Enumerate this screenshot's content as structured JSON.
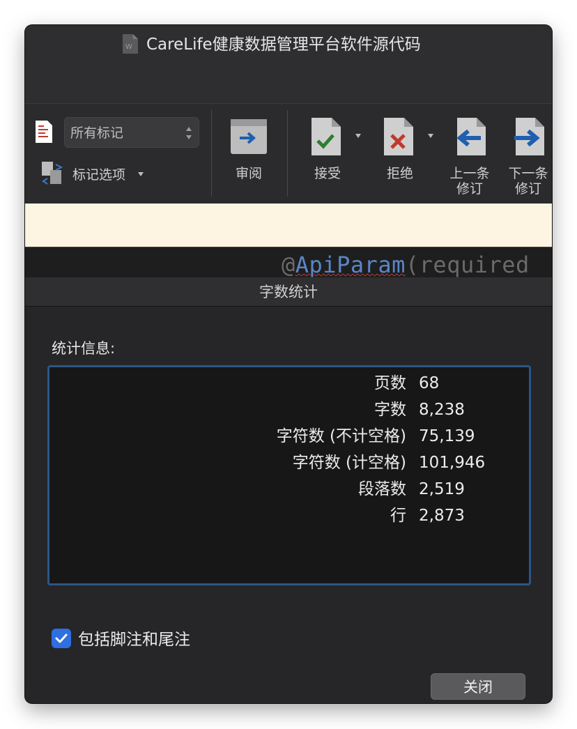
{
  "window": {
    "title": "CareLife健康数据管理平台软件源代码",
    "doc_icon": "word-document-icon"
  },
  "ribbon": {
    "markup_display_value": "所有标记",
    "markup_options_label": "标记选项",
    "review_label": "审阅",
    "accept_label": "接受",
    "reject_label": "拒绝",
    "previous_change_label_line1": "上一条",
    "previous_change_label_line2": "修订",
    "next_change_label_line1": "下一条",
    "next_change_label_line2": "修订"
  },
  "editor": {
    "code_prefix": "@",
    "code_keyword": "ApiParam",
    "code_suffix": "(required"
  },
  "dialog": {
    "title": "字数统计",
    "stats_heading": "统计信息:",
    "stats": [
      {
        "name": "页数",
        "value": "68"
      },
      {
        "name": "字数",
        "value": "8,238"
      },
      {
        "name": "字符数 (不计空格)",
        "value": "75,139"
      },
      {
        "name": "字符数 (计空格)",
        "value": "101,946"
      },
      {
        "name": "段落数",
        "value": "2,519"
      },
      {
        "name": "行",
        "value": "2,873"
      }
    ],
    "include_footnotes_label": "包括脚注和尾注",
    "include_footnotes_checked": true,
    "close_label": "关闭"
  },
  "colors": {
    "accent": "#2f6fe0",
    "box_border": "#2c5586",
    "accept_green": "#2e7d32",
    "reject_red": "#c0392b",
    "arrow_blue": "#1f5fae"
  }
}
